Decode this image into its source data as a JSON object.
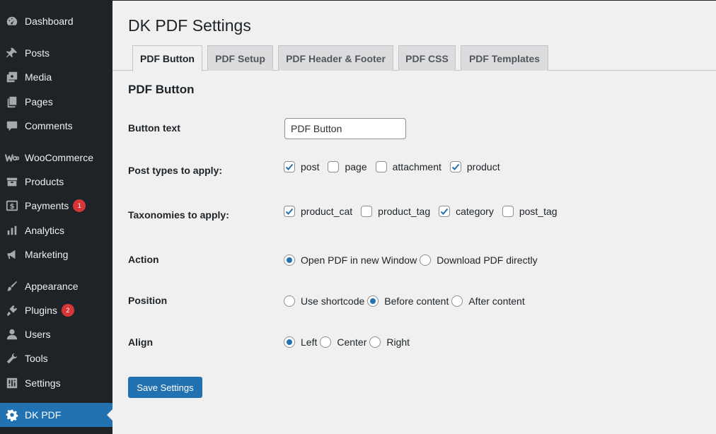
{
  "sidebar": {
    "items": [
      {
        "label": "Dashboard",
        "icon": "dashboard-icon"
      },
      {
        "label": "Posts",
        "icon": "pin-icon"
      },
      {
        "label": "Media",
        "icon": "media-icon"
      },
      {
        "label": "Pages",
        "icon": "pages-icon"
      },
      {
        "label": "Comments",
        "icon": "comments-icon"
      },
      {
        "label": "WooCommerce",
        "icon": "woocommerce-icon"
      },
      {
        "label": "Products",
        "icon": "products-icon"
      },
      {
        "label": "Payments",
        "icon": "payments-icon",
        "badge": "1"
      },
      {
        "label": "Analytics",
        "icon": "analytics-icon"
      },
      {
        "label": "Marketing",
        "icon": "megaphone-icon"
      },
      {
        "label": "Appearance",
        "icon": "brush-icon"
      },
      {
        "label": "Plugins",
        "icon": "plugin-icon",
        "badge": "2"
      },
      {
        "label": "Users",
        "icon": "user-icon"
      },
      {
        "label": "Tools",
        "icon": "wrench-icon"
      },
      {
        "label": "Settings",
        "icon": "settings-icon"
      },
      {
        "label": "DK PDF",
        "icon": "gear-icon",
        "active": true
      }
    ]
  },
  "page": {
    "title": "DK PDF Settings"
  },
  "tabs": [
    {
      "label": "PDF Button",
      "active": true
    },
    {
      "label": "PDF Setup"
    },
    {
      "label": "PDF Header & Footer"
    },
    {
      "label": "PDF CSS"
    },
    {
      "label": "PDF Templates"
    }
  ],
  "form": {
    "section_title": "PDF Button",
    "button_text": {
      "label": "Button text",
      "value": "PDF Button"
    },
    "post_types": {
      "label": "Post types to apply:",
      "options": [
        {
          "label": "post",
          "checked": true
        },
        {
          "label": "page",
          "checked": false
        },
        {
          "label": "attachment",
          "checked": false
        },
        {
          "label": "product",
          "checked": true
        }
      ]
    },
    "taxonomies": {
      "label": "Taxonomies to apply:",
      "options": [
        {
          "label": "product_cat",
          "checked": true
        },
        {
          "label": "product_tag",
          "checked": false
        },
        {
          "label": "category",
          "checked": true
        },
        {
          "label": "post_tag",
          "checked": false
        }
      ]
    },
    "action": {
      "label": "Action",
      "options": [
        {
          "label": "Open PDF in new Window",
          "checked": true
        },
        {
          "label": "Download PDF directly",
          "checked": false
        }
      ]
    },
    "position": {
      "label": "Position",
      "options": [
        {
          "label": "Use shortcode",
          "checked": false
        },
        {
          "label": "Before content",
          "checked": true
        },
        {
          "label": "After content",
          "checked": false
        }
      ]
    },
    "align": {
      "label": "Align",
      "options": [
        {
          "label": "Left",
          "checked": true
        },
        {
          "label": "Center",
          "checked": false
        },
        {
          "label": "Right",
          "checked": false
        }
      ]
    },
    "save_label": "Save Settings"
  },
  "colors": {
    "sidebar_bg": "#1d2327",
    "accent": "#2271b1",
    "badge": "#d63638",
    "page_bg": "#f0f0f1"
  }
}
